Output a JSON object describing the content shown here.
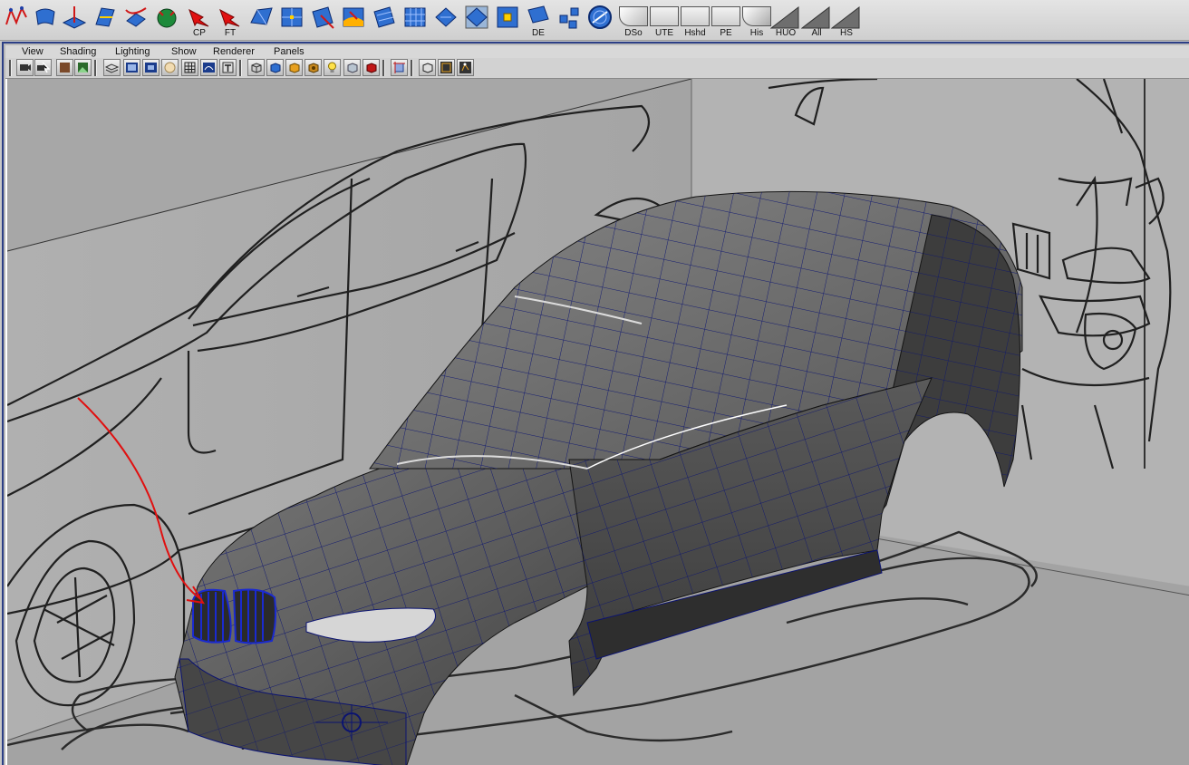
{
  "shelf": {
    "tools": [
      {
        "name": "curve-tool-icon",
        "label": ""
      },
      {
        "name": "extrude-surface-icon",
        "label": ""
      },
      {
        "name": "planar-surface-icon",
        "label": ""
      },
      {
        "name": "skin-surface-icon",
        "label": ""
      },
      {
        "name": "rail-surface-icon",
        "label": ""
      },
      {
        "name": "sphere-surface-icon",
        "label": ""
      },
      {
        "name": "cp-arrow-icon",
        "label": "CP"
      },
      {
        "name": "ft-arrow-icon",
        "label": "FT"
      },
      {
        "name": "fillet-surface-icon",
        "label": ""
      },
      {
        "name": "blend-icon",
        "label": ""
      },
      {
        "name": "trim-surface-icon",
        "label": ""
      },
      {
        "name": "patch-icon",
        "label": ""
      },
      {
        "name": "detach-icon",
        "label": ""
      },
      {
        "name": "grid-surface-icon",
        "label": ""
      },
      {
        "name": "offset-surface-icon",
        "label": ""
      },
      {
        "name": "align-surface-icon",
        "label": ""
      },
      {
        "name": "snap-surface-icon",
        "label": ""
      },
      {
        "name": "de-surface-icon",
        "label": "DE"
      },
      {
        "name": "connect-icon",
        "label": ""
      },
      {
        "name": "globe-icon",
        "label": ""
      }
    ],
    "shaders": [
      {
        "name": "dso-shader",
        "label": "DSo"
      },
      {
        "name": "ute-shader",
        "label": "UTE"
      },
      {
        "name": "hshd-shader",
        "label": "Hshd"
      },
      {
        "name": "pe-shader",
        "label": "PE"
      },
      {
        "name": "his-shader",
        "label": "His"
      },
      {
        "name": "huo-shader",
        "label": "HUO"
      },
      {
        "name": "all-shader",
        "label": "All"
      },
      {
        "name": "hs-shader",
        "label": "HS"
      }
    ]
  },
  "menu": [
    "View",
    "Shading",
    "Lighting",
    "Show",
    "Renderer",
    "Panels"
  ],
  "colors": {
    "accent": "#1a5fd0",
    "wire": "#0b1370",
    "annotation": "#e01010",
    "window_border": "#2c3f86"
  }
}
